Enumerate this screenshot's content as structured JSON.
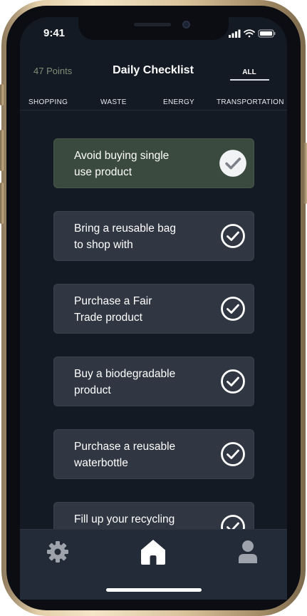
{
  "status_bar": {
    "time": "9:41"
  },
  "header": {
    "points": "47 Points",
    "title": "Daily Checklist",
    "filter_all": "ALL"
  },
  "categories": [
    "SHOPPING",
    "WASTE",
    "ENERGY",
    "TRANSPORTATION"
  ],
  "tasks": [
    {
      "label_line1": "Avoid buying single",
      "label_line2": "use product",
      "completed": true
    },
    {
      "label_line1": "Bring a reusable bag",
      "label_line2": "to shop with",
      "completed": false
    },
    {
      "label_line1": "Purchase a Fair",
      "label_line2": "Trade product",
      "completed": false
    },
    {
      "label_line1": "Buy a biodegradable",
      "label_line2": "product",
      "completed": false
    },
    {
      "label_line1": "Purchase a reusable",
      "label_line2": "waterbottle",
      "completed": false
    },
    {
      "label_line1": "Fill up your recycling",
      "label_line2": "",
      "completed": false
    }
  ],
  "tab_bar": {
    "items": [
      "gear-icon",
      "home-icon",
      "user-icon"
    ]
  },
  "colors": {
    "background": "#141a24",
    "card": "#303642",
    "card_completed": "#3a4a3e",
    "points_text": "#7f8f77",
    "tab_bar": "#232a38"
  }
}
